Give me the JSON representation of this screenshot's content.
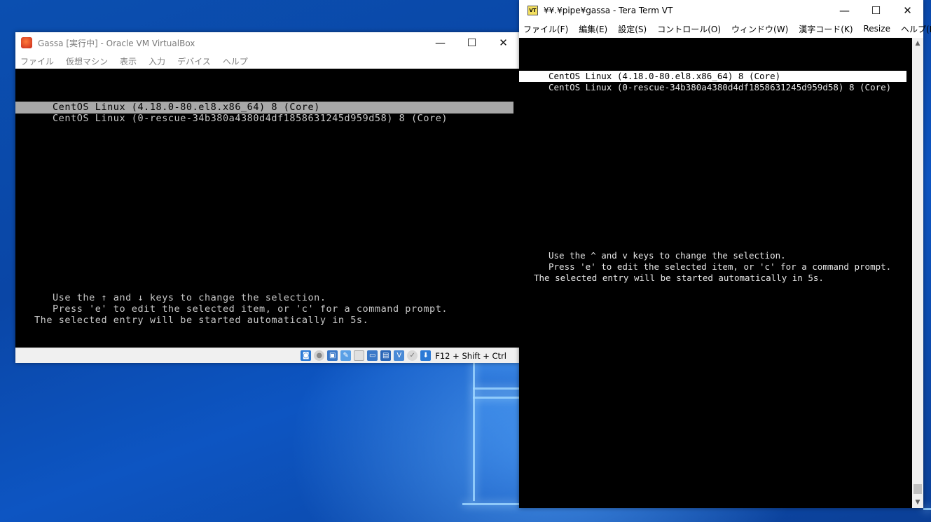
{
  "vbox": {
    "title": "Gassa [実行中] - Oracle VM VirtualBox",
    "menu": [
      "ファイル",
      "仮想マシン",
      "表示",
      "入力",
      "デバイス",
      "ヘルプ"
    ],
    "grub": {
      "entries": [
        "CentOS Linux (4.18.0-80.el8.x86_64) 8 (Core)",
        "CentOS Linux (0-rescue-34b380a4380d4df1858631245d959d58) 8 (Core)"
      ],
      "help": [
        "Use the ↑ and ↓ keys to change the selection.",
        "Press 'e' to edit the selected item, or 'c' for a command prompt.",
        "The selected entry will be started automatically in 5s."
      ]
    },
    "host_key": "F12 + Shift + Ctrl"
  },
  "teraterm": {
    "title": "¥¥.¥pipe¥gassa - Tera Term VT",
    "menu": [
      "ファイル(F)",
      "編集(E)",
      "設定(S)",
      "コントロール(O)",
      "ウィンドウ(W)",
      "漢字コード(K)",
      "Resize",
      "ヘルプ(H)"
    ],
    "grub": {
      "entries": [
        "CentOS Linux (4.18.0-80.el8.x86_64) 8 (Core)",
        "CentOS Linux (0-rescue-34b380a4380d4df1858631245d959d58) 8 (Core)"
      ],
      "help": [
        "Use the ^ and v keys to change the selection.",
        "Press 'e' to edit the selected item, or 'c' for a command prompt.",
        "The selected entry will be started automatically in 5s."
      ]
    }
  },
  "window_controls": {
    "minimize": "—",
    "maximize": "☐",
    "close": "✕"
  },
  "colors": {
    "desktop": "#0a46a6",
    "vbox_selection": "#a8a8a8",
    "tt_selection": "#ffffff"
  }
}
